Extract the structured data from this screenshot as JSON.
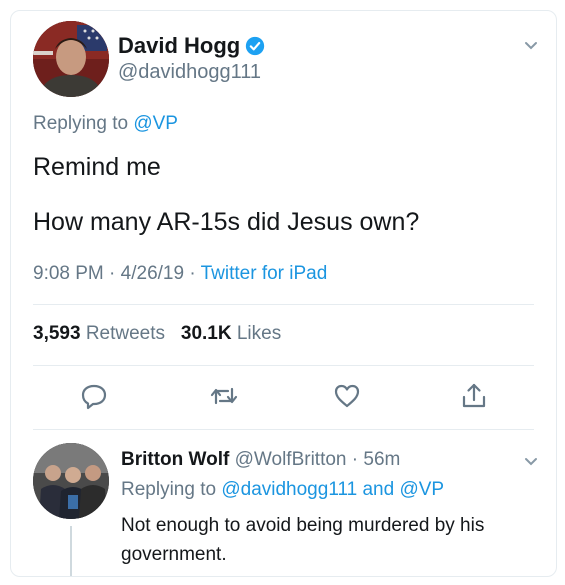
{
  "tweet": {
    "author_name": "David Hogg",
    "author_handle": "@davidhogg111",
    "replying_prefix": "Replying to",
    "replying_to": "@VP",
    "text_line1": "Remind me",
    "text_line2": "How many AR-15s did Jesus own?",
    "time": "9:08 PM",
    "date": "4/26/19",
    "source": "Twitter for iPad",
    "retweets_count": "3,593",
    "retweets_label": "Retweets",
    "likes_count": "30.1K",
    "likes_label": "Likes",
    "verified": true
  },
  "actions": {
    "reply_icon": "reply-icon",
    "retweet_icon": "retweet-icon",
    "like_icon": "heart-icon",
    "share_icon": "share-icon"
  },
  "reply": {
    "author_name": "Britton Wolf",
    "author_handle": "@WolfBritton",
    "age": "56m",
    "replying_prefix": "Replying to",
    "replying_to_1": "@davidhogg111",
    "replying_and": "and",
    "replying_to_2": "@VP",
    "text": "Not enough to avoid being murdered by his government."
  },
  "colors": {
    "link_blue": "#1b95e0",
    "muted_gray": "#657786",
    "text_dark": "#14171a",
    "divider": "#e6ecf0"
  }
}
